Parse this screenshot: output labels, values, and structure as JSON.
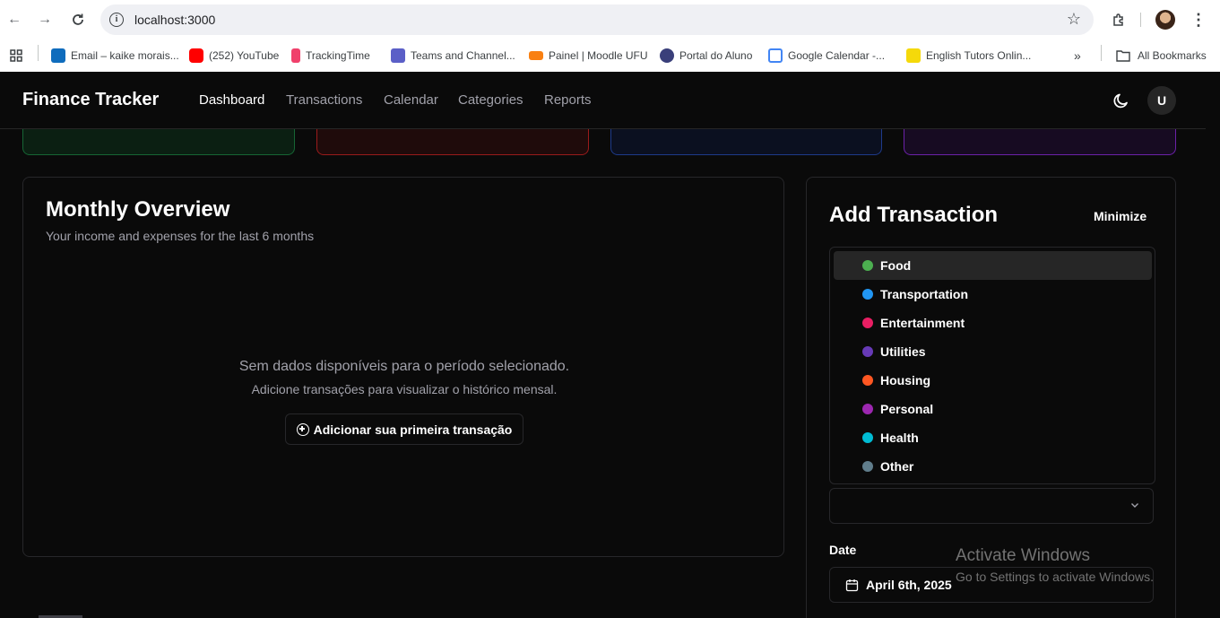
{
  "browser": {
    "url": "localhost:3000",
    "bookmarks": [
      {
        "label": "Email – kaike morais...",
        "color": "#0f6cbd"
      },
      {
        "label": "(252) YouTube",
        "color": "#ff0000"
      },
      {
        "label": "TrackingTime",
        "color": "#f0406b"
      },
      {
        "label": "Teams and Channel...",
        "color": "#5b5fc7"
      },
      {
        "label": "Painel | Moodle UFU",
        "color": "#f98012"
      },
      {
        "label": "Portal do Aluno",
        "color": "#3a3f7a"
      },
      {
        "label": "Google Calendar -...",
        "color": "#4285f4"
      },
      {
        "label": "English Tutors Onlin...",
        "color": "#f5d90a"
      }
    ],
    "all_bookmarks": "All Bookmarks"
  },
  "nav": {
    "brand": "Finance Tracker",
    "links": [
      "Dashboard",
      "Transactions",
      "Calendar",
      "Categories",
      "Reports"
    ],
    "active": "Dashboard",
    "user_initial": "U"
  },
  "stat_cards": [
    {
      "border": "#166534",
      "bg": "#0b1f12"
    },
    {
      "border": "#991b1b",
      "bg": "#1f0b0b"
    },
    {
      "border": "#1e3a8a",
      "bg": "#0b1020"
    },
    {
      "border": "#6b21a8",
      "bg": "#170b22"
    }
  ],
  "overview": {
    "title": "Monthly Overview",
    "subtitle": "Your income and expenses for the last 6 months",
    "empty_title": "Sem dados disponíveis para o período selecionado.",
    "empty_sub": "Adicione transações para visualizar o histórico mensal.",
    "add_button": "Adicionar sua primeira transação"
  },
  "add_transaction": {
    "title": "Add Transaction",
    "minimize": "Minimize",
    "categories": [
      {
        "label": "Food",
        "color": "#4caf50"
      },
      {
        "label": "Transportation",
        "color": "#2196f3"
      },
      {
        "label": "Entertainment",
        "color": "#e91e63"
      },
      {
        "label": "Utilities",
        "color": "#673ab7"
      },
      {
        "label": "Housing",
        "color": "#ff5722"
      },
      {
        "label": "Personal",
        "color": "#9c27b0"
      },
      {
        "label": "Health",
        "color": "#00bcd4"
      },
      {
        "label": "Other",
        "color": "#607d8b"
      }
    ],
    "highlighted": "Food",
    "date_label": "Date",
    "date_value": "April 6th, 2025"
  },
  "watermark": {
    "line1": "Activate Windows",
    "line2": "Go to Settings to activate Windows."
  }
}
